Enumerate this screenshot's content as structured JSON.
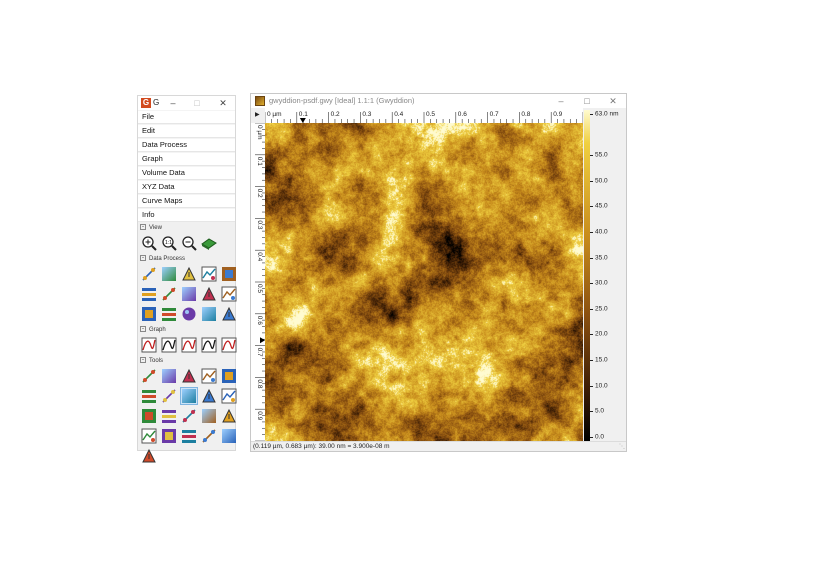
{
  "toolbox": {
    "title": "G",
    "menu": [
      "File",
      "Edit",
      "Data Process",
      "Graph",
      "Volume Data",
      "XYZ Data",
      "Curve Maps",
      "Info"
    ],
    "sections": {
      "view": "View",
      "data_process": "Data Process",
      "graph": "Graph",
      "tools": "Tools"
    },
    "icons": {
      "view": [
        "zoom-in-icon",
        "zoom-1to1-icon",
        "zoom-out-icon",
        "3d-view-icon"
      ],
      "data_process": [
        "line-correction-icon",
        "crop-icon",
        "scars-icon",
        "duplicate-icon",
        "plane-level-icon",
        "facet-level-icon",
        "row-align-icon",
        "polynomial-icon",
        "grains-icon",
        "fft-icon",
        "spot-remove-icon",
        "mask-icon",
        "sphere-icon",
        "gradient-icon",
        "dither-icon"
      ],
      "graph": [
        "graph-fit-icon",
        "graph-peaks-icon",
        "graph-measure-icon",
        "graph-cut-icon",
        "graph-export-icon"
      ],
      "tools": [
        "pointer-icon",
        "distance-icon",
        "cross-icon",
        "profile-icon",
        "spectro-icon",
        "level-tool-icon",
        "color-range-icon",
        "line-stats-icon",
        "roughness-icon",
        "filter-tool-icon",
        "grain-tool-icon",
        "stats-icon",
        "shade-icon",
        "path-level-icon",
        "mark-icon",
        "spot-tool-icon",
        "selection-icon",
        "mask-editor-icon",
        "corr-icon",
        "readvalue-icon",
        "line-tool-icon"
      ],
      "tools_selected": 7
    }
  },
  "datawin": {
    "title": "gwyddion-psdf.gwy [Ideal] 1.1:1 (Gwyddion)",
    "h_ticks": [
      "0 µm",
      "0.1",
      "0.2",
      "0.3",
      "0.4",
      "0.5",
      "0.6",
      "0.7",
      "0.8",
      "0.9"
    ],
    "v_ticks": [
      "0 µm",
      "0.1",
      "0.2",
      "0.3",
      "0.4",
      "0.5",
      "0.6",
      "0.7",
      "0.8",
      "0.9"
    ],
    "colorbar_labels": [
      "63.0 nm",
      "55.0",
      "50.0",
      "45.0",
      "40.0",
      "35.0",
      "30.0",
      "25.0",
      "20.0",
      "15.0",
      "10.0",
      "5.0",
      "0.0"
    ],
    "colorbar_values": [
      63.0,
      55.0,
      50.0,
      45.0,
      40.0,
      35.0,
      30.0,
      25.0,
      20.0,
      15.0,
      10.0,
      5.0,
      0.0
    ],
    "colorbar_range": [
      0.0,
      63.0
    ],
    "cursor": {
      "x_um": 0.119,
      "y_um": 0.683
    },
    "status": "(0.119 µm, 0.683 µm): 39.00 nm = 3.900e-08 m",
    "colors": {
      "high": "#fffbd0",
      "mid": "#c88c1c",
      "low": "#000000"
    }
  }
}
